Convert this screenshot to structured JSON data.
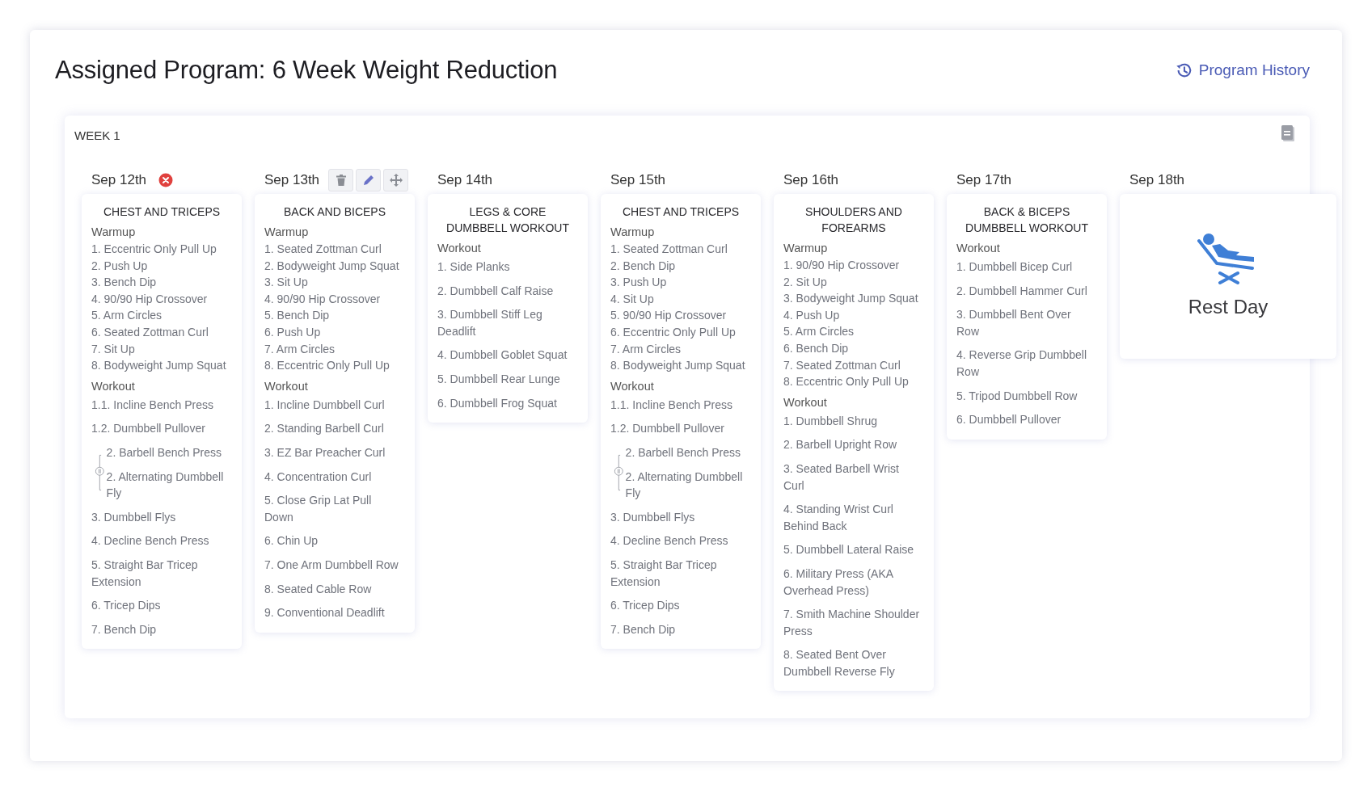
{
  "page": {
    "title": "Assigned Program: 6 Week Weight Reduction",
    "history_link": "Program History"
  },
  "week": {
    "label": "WEEK 1",
    "days": [
      {
        "date": "Sep 12th",
        "actions": [
          {
            "kind": "remove"
          }
        ],
        "kind": "workout",
        "title": "CHEST AND TRICEPS",
        "sections": [
          {
            "label": "Warmup",
            "items": [
              {
                "text": "1. Eccentric Only Pull Up"
              },
              {
                "text": "2. Push Up"
              },
              {
                "text": "3. Bench Dip"
              },
              {
                "text": "4. 90/90 Hip Crossover"
              },
              {
                "text": "5. Arm Circles"
              },
              {
                "text": "6. Seated Zottman Curl"
              },
              {
                "text": "7. Sit Up"
              },
              {
                "text": "8. Bodyweight Jump Squat"
              }
            ]
          },
          {
            "label": "Workout",
            "items": [
              {
                "text": "1.1. Incline Bench Press"
              },
              {
                "text": "1.2. Dumbbell Pullover"
              },
              {
                "group": [
                  "2. Barbell Bench Press",
                  "2. Alternating Dumbbell Fly"
                ]
              },
              {
                "text": "3. Dumbbell Flys"
              },
              {
                "text": "4. Decline Bench Press"
              },
              {
                "text": "5. Straight Bar Tricep Extension"
              },
              {
                "text": "6. Tricep Dips"
              },
              {
                "text": "7. Bench Dip"
              }
            ]
          }
        ]
      },
      {
        "date": "Sep 13th",
        "actions": [
          {
            "kind": "delete"
          },
          {
            "kind": "edit"
          },
          {
            "kind": "move"
          }
        ],
        "kind": "workout",
        "title": "BACK AND BICEPS",
        "sections": [
          {
            "label": "Warmup",
            "items": [
              {
                "text": "1. Seated Zottman Curl"
              },
              {
                "text": "2. Bodyweight Jump Squat"
              },
              {
                "text": "3. Sit Up"
              },
              {
                "text": "4. 90/90 Hip Crossover"
              },
              {
                "text": "5. Bench Dip"
              },
              {
                "text": "6. Push Up"
              },
              {
                "text": "7. Arm Circles"
              },
              {
                "text": "8. Eccentric Only Pull Up"
              }
            ]
          },
          {
            "label": "Workout",
            "items": [
              {
                "text": "1. Incline Dumbbell Curl"
              },
              {
                "text": "2. Standing Barbell Curl"
              },
              {
                "text": "3. EZ Bar Preacher Curl"
              },
              {
                "text": "4. Concentration Curl"
              },
              {
                "text": "5. Close Grip Lat Pull Down"
              },
              {
                "text": "6. Chin Up"
              },
              {
                "text": "7. One Arm Dumbbell Row"
              },
              {
                "text": "8. Seated Cable Row"
              },
              {
                "text": "9. Conventional Deadlift"
              }
            ]
          }
        ]
      },
      {
        "date": "Sep 14th",
        "kind": "workout",
        "title": "LEGS & CORE DUMBBELL WORKOUT",
        "sections": [
          {
            "label": "Workout",
            "items": [
              {
                "text": "1. Side Planks"
              },
              {
                "text": "2. Dumbbell Calf Raise"
              },
              {
                "text": "3. Dumbbell Stiff Leg Deadlift"
              },
              {
                "text": "4. Dumbbell Goblet Squat"
              },
              {
                "text": "5. Dumbbell Rear Lunge"
              },
              {
                "text": "6. Dumbbell Frog Squat"
              }
            ]
          }
        ]
      },
      {
        "date": "Sep 15th",
        "kind": "workout",
        "title": "CHEST AND TRICEPS",
        "sections": [
          {
            "label": "Warmup",
            "items": [
              {
                "text": "1. Seated Zottman Curl"
              },
              {
                "text": "2. Bench Dip"
              },
              {
                "text": "3. Push Up"
              },
              {
                "text": "4. Sit Up"
              },
              {
                "text": "5. 90/90 Hip Crossover"
              },
              {
                "text": "6. Eccentric Only Pull Up"
              },
              {
                "text": "7. Arm Circles"
              },
              {
                "text": "8. Bodyweight Jump Squat"
              }
            ]
          },
          {
            "label": "Workout",
            "items": [
              {
                "text": "1.1. Incline Bench Press"
              },
              {
                "text": "1.2. Dumbbell Pullover"
              },
              {
                "group": [
                  "2. Barbell Bench Press",
                  "2. Alternating Dumbbell Fly"
                ]
              },
              {
                "text": "3. Dumbbell Flys"
              },
              {
                "text": "4. Decline Bench Press"
              },
              {
                "text": "5. Straight Bar Tricep Extension"
              },
              {
                "text": "6. Tricep Dips"
              },
              {
                "text": "7. Bench Dip"
              }
            ]
          }
        ]
      },
      {
        "date": "Sep 16th",
        "kind": "workout",
        "title": "SHOULDERS AND FOREARMS",
        "sections": [
          {
            "label": "Warmup",
            "items": [
              {
                "text": "1. 90/90 Hip Crossover"
              },
              {
                "text": "2. Sit Up"
              },
              {
                "text": "3. Bodyweight Jump Squat"
              },
              {
                "text": "4. Push Up"
              },
              {
                "text": "5. Arm Circles"
              },
              {
                "text": "6. Bench Dip"
              },
              {
                "text": "7. Seated Zottman Curl"
              },
              {
                "text": "8. Eccentric Only Pull Up"
              }
            ]
          },
          {
            "label": "Workout",
            "items": [
              {
                "text": "1. Dumbbell Shrug"
              },
              {
                "text": "2. Barbell Upright Row"
              },
              {
                "text": "3. Seated Barbell Wrist Curl"
              },
              {
                "text": "4. Standing Wrist Curl Behind Back"
              },
              {
                "text": "5. Dumbbell Lateral Raise"
              },
              {
                "text": "6. Military Press (AKA Overhead Press)"
              },
              {
                "text": "7. Smith Machine Shoulder Press"
              },
              {
                "text": "8. Seated Bent Over Dumbbell Reverse Fly"
              }
            ]
          }
        ]
      },
      {
        "date": "Sep 17th",
        "kind": "workout",
        "title": "BACK & BICEPS DUMBBELL WORKOUT",
        "sections": [
          {
            "label": "Workout",
            "items": [
              {
                "text": "1. Dumbbell Bicep Curl"
              },
              {
                "text": "2. Dumbbell Hammer Curl"
              },
              {
                "text": "3. Dumbbell Bent Over Row"
              },
              {
                "text": "4. Reverse Grip Dumbbell Row"
              },
              {
                "text": "5. Tripod Dumbbell Row"
              },
              {
                "text": "6. Dumbbell Pullover"
              }
            ]
          }
        ]
      },
      {
        "date": "Sep 18th",
        "kind": "rest",
        "title": "Rest Day"
      }
    ]
  }
}
